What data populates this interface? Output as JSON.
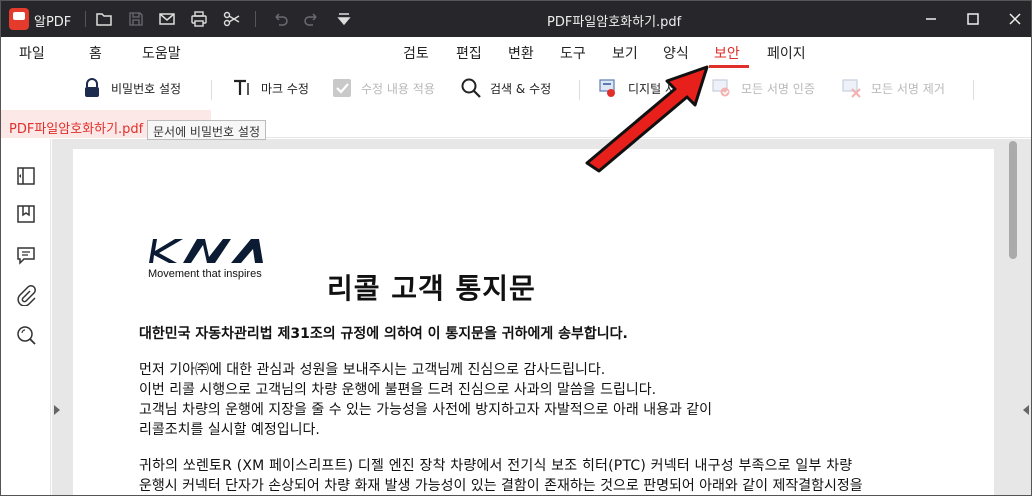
{
  "titlebar": {
    "app_name": "알PDF",
    "doc_title": "PDF파일암호화하기.pdf",
    "icons": [
      "folder-icon",
      "save-icon",
      "mail-icon",
      "print-icon",
      "scissors-icon",
      "undo-icon",
      "redo-icon",
      "dropdown-icon"
    ],
    "window_controls": [
      "minimize",
      "maximize",
      "close"
    ]
  },
  "menu": {
    "items": [
      "파일",
      "홈",
      "도움말",
      "검토",
      "편집",
      "변환",
      "도구",
      "보기",
      "양식",
      "보안",
      "페이지"
    ],
    "active": "보안"
  },
  "toolbar": {
    "password_settings": "비밀번호 설정",
    "mark_edit": "마크 수정",
    "apply_edits": "수정 내용 적용",
    "search_edit": "검색 & 수정",
    "digital_sign": "디지털 서",
    "verify_all": "모든 서명 인증",
    "remove_all": "모든 서명 제거"
  },
  "tabs": {
    "doc_tab": "PDF파일암호화하기.pdf",
    "tooltip": "문서에 비밀번호 설정"
  },
  "sidebar": {
    "icons": [
      "panel-icon",
      "bookmark-icon",
      "comment-icon",
      "attachment-icon",
      "search-icon"
    ]
  },
  "document": {
    "tagline": "Movement that inspires",
    "heading": "리콜 고객 통지문",
    "subheading": "대한민국 자동차관리법 제31조의 규정에 의하여 이 통지문을 귀하에게 송부합니다.",
    "para1": [
      "먼저 기아㈜에 대한 관심과 성원을 보내주시는 고객님께 진심으로 감사드립니다.",
      "이번 리콜 시행으로 고객님의 차량 운행에 불편을 드려 진심으로 사과의 말씀을 드립니다.",
      "고객님 차량의 운행에 지장을 줄 수 있는 가능성을 사전에 방지하고자 자발적으로 아래 내용과 같이",
      "리콜조치를 실시할 예정입니다."
    ],
    "para2": [
      "귀하의 쏘렌토R (XM 페이스리프트) 디젤 엔진 장착 차량에서 전기식 보조 히터(PTC) 커넥터 내구성 부족으로 일부 차량",
      "운행시 커넥터 단자가 손상되어 차량 화재 발생 가능성이 있는 결함이 존재하는 것으로 판명되어 아래와 같이 제작결함시정을"
    ]
  },
  "colors": {
    "accent": "#e0302a",
    "titlebar_bg": "#26262b",
    "tab_bg": "#fde8e8",
    "viewer_bg": "#e7e7e7"
  }
}
